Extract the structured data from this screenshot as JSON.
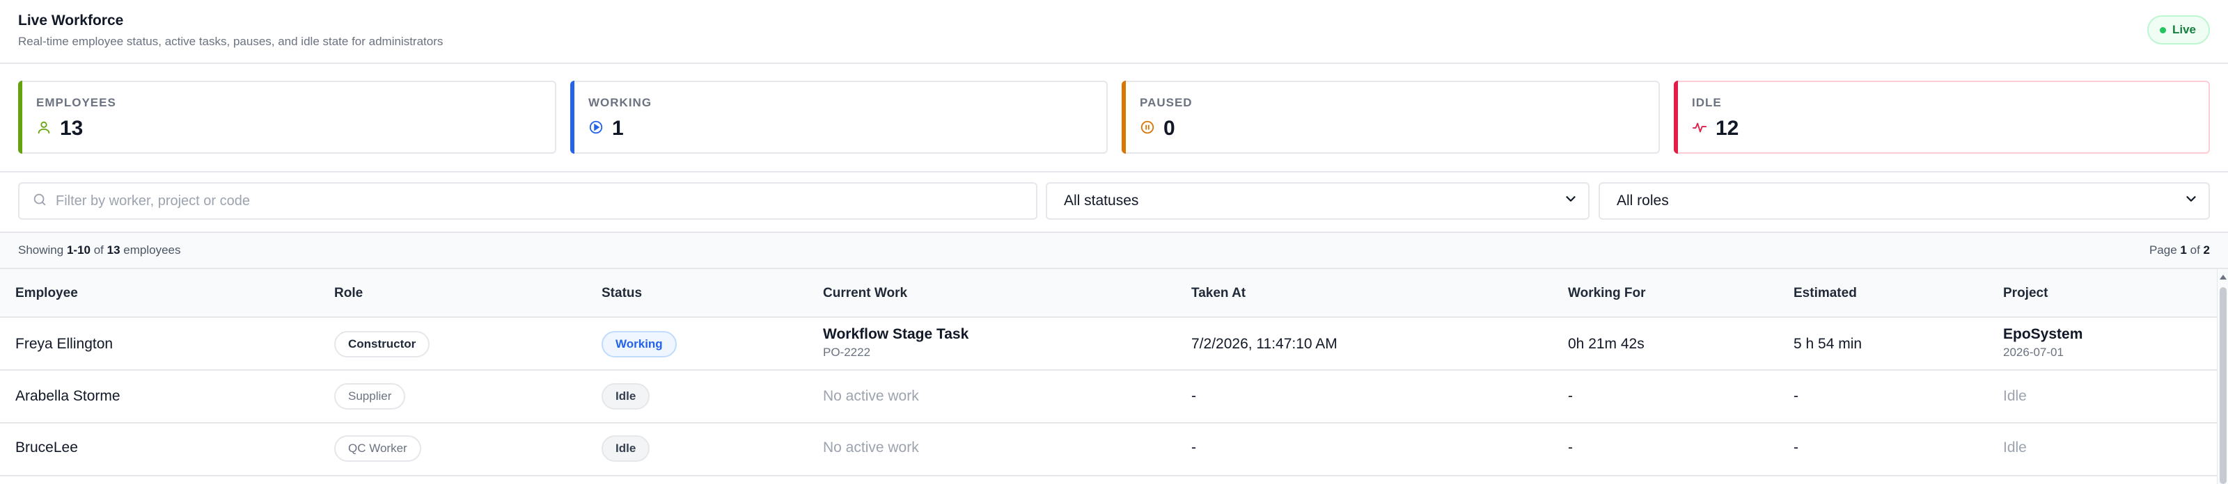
{
  "header": {
    "title": "Live Workforce",
    "subtitle": "Real-time employee status, active tasks, pauses, and idle state for administrators",
    "live_label": "Live"
  },
  "stats": [
    {
      "label": "EMPLOYEES",
      "value": "13",
      "icon": "person-icon",
      "color": "#65a30d"
    },
    {
      "label": "WORKING",
      "value": "1",
      "icon": "play-circle-icon",
      "color": "#2563eb"
    },
    {
      "label": "PAUSED",
      "value": "0",
      "icon": "pause-circle-icon",
      "color": "#d97706"
    },
    {
      "label": "IDLE",
      "value": "12",
      "icon": "activity-icon",
      "color": "#e11d48"
    }
  ],
  "filters": {
    "search_placeholder": "Filter by worker, project or code",
    "status_selected": "All statuses",
    "role_selected": "All roles"
  },
  "summary": {
    "showing_label": "Showing",
    "range": "1-10",
    "of_label": "of",
    "total": "13",
    "unit": "employees",
    "page_label": "Page",
    "page": "1",
    "page_of": "of",
    "pages": "2"
  },
  "table": {
    "columns": [
      "Employee",
      "Role",
      "Status",
      "Current Work",
      "Taken At",
      "Working For",
      "Estimated",
      "Project"
    ],
    "rows": [
      {
        "employee": "Freya Ellington",
        "role": "Constructor",
        "status": "Working",
        "work_title": "Workflow Stage Task",
        "work_code": "PO-2222",
        "taken_at": "7/2/2026, 11:47:10 AM",
        "working_for": "0h 21m 42s",
        "estimated": "5 h 54 min",
        "project": "EpoSystem",
        "project_date": "2026-07-01"
      },
      {
        "employee": "Arabella Storme",
        "role": "Supplier",
        "status": "Idle",
        "work_title": "No active work",
        "work_code": "",
        "taken_at": "-",
        "working_for": "-",
        "estimated": "-",
        "project": "Idle",
        "project_date": ""
      },
      {
        "employee": "BruceLee",
        "role": "QC Worker",
        "status": "Idle",
        "work_title": "No active work",
        "work_code": "",
        "taken_at": "-",
        "working_for": "-",
        "estimated": "-",
        "project": "Idle",
        "project_date": ""
      }
    ]
  }
}
